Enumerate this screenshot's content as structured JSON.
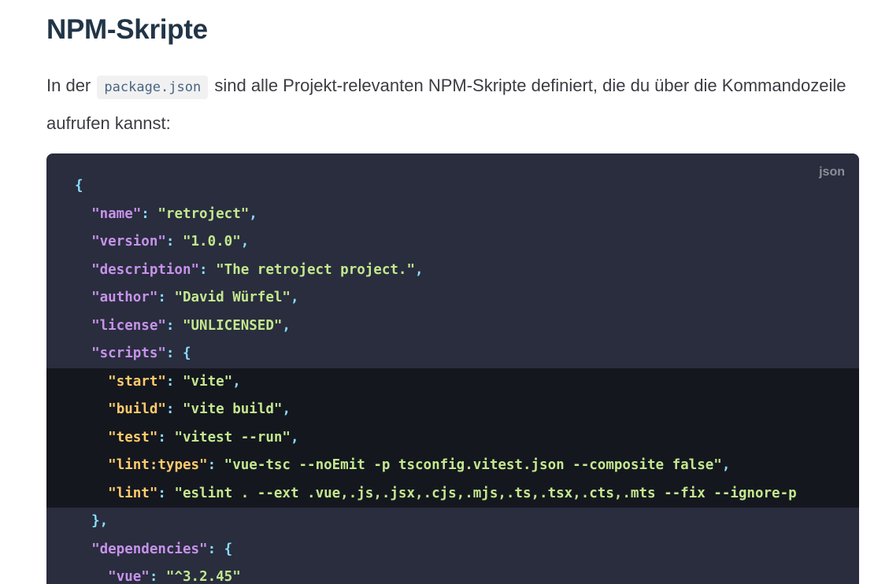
{
  "heading": "NPM-Skripte",
  "intro": {
    "before": "In der",
    "code": "package.json",
    "after": "sind alle Projekt-relevanten NPM-Skripte definiert, die du über die Kommandozeile aufrufen kannst:"
  },
  "code_block": {
    "language": "json",
    "lines": [
      {
        "indent": "",
        "text": "{"
      },
      {
        "indent": "  ",
        "key": "name",
        "value": "retroject",
        "tail": ","
      },
      {
        "indent": "  ",
        "key": "version",
        "value": "1.0.0",
        "tail": ","
      },
      {
        "indent": "  ",
        "key": "description",
        "value": "The retroject project.",
        "tail": ","
      },
      {
        "indent": "  ",
        "key": "author",
        "value": "David Würfel",
        "tail": ","
      },
      {
        "indent": "  ",
        "key": "license",
        "value": "UNLICENSED",
        "tail": ","
      },
      {
        "indent": "  ",
        "key": "scripts",
        "open": "{"
      },
      {
        "indent": "    ",
        "key": "start",
        "value": "vite",
        "tail": ",",
        "highlight": true
      },
      {
        "indent": "    ",
        "key": "build",
        "value": "vite build",
        "tail": ",",
        "highlight": true
      },
      {
        "indent": "    ",
        "key": "test",
        "value": "vitest --run",
        "tail": ",",
        "highlight": true
      },
      {
        "indent": "    ",
        "key": "lint:types",
        "value": "vue-tsc --noEmit -p tsconfig.vitest.json --composite false",
        "tail": ",",
        "highlight": true
      },
      {
        "indent": "    ",
        "key": "lint",
        "value": "eslint . --ext .vue,.js,.jsx,.cjs,.mjs,.ts,.tsx,.cts,.mts --fix --ignore-p",
        "open_quote_only": true,
        "highlight": true
      },
      {
        "indent": "  ",
        "text": "},"
      },
      {
        "indent": "  ",
        "key": "dependencies",
        "open": "{"
      },
      {
        "indent": "    ",
        "key": "vue",
        "value": "^3.2.45",
        "tail": ""
      }
    ]
  }
}
